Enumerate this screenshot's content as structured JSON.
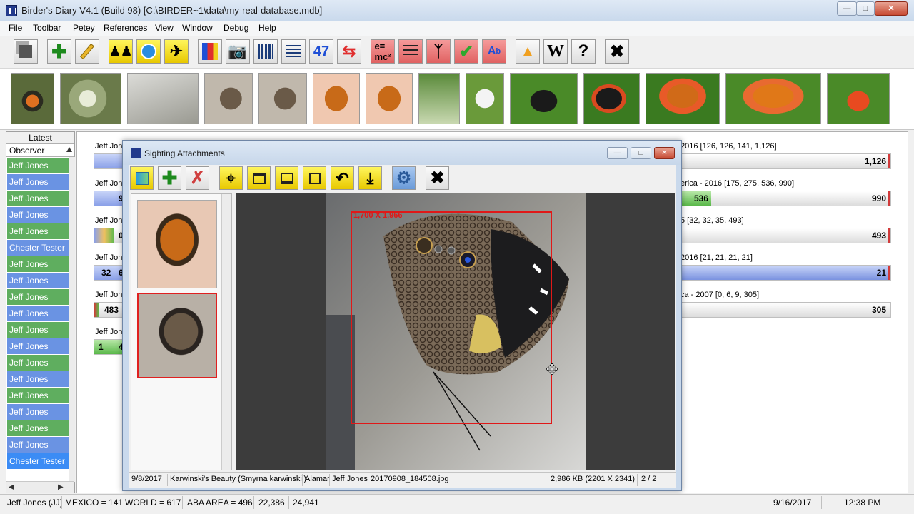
{
  "window": {
    "title": "Birder's Diary V4.1 (Build 98) [C:\\BIRDER~1\\data\\my-real-database.mdb]"
  },
  "menu": [
    "File",
    "Toolbar",
    "Petey",
    "References",
    "View",
    "Window",
    "Debug",
    "Help"
  ],
  "left_panel": {
    "latest_label": "Latest",
    "observer_header": "Observer",
    "rows": [
      {
        "name": "Jeff Jones",
        "color": "green"
      },
      {
        "name": "Jeff Jones",
        "color": "blue"
      },
      {
        "name": "Jeff Jones",
        "color": "green"
      },
      {
        "name": "Jeff Jones",
        "color": "blue"
      },
      {
        "name": "Jeff Jones",
        "color": "green"
      },
      {
        "name": "Chester Tester",
        "color": "blue"
      },
      {
        "name": "Jeff Jones",
        "color": "green"
      },
      {
        "name": "Jeff Jones",
        "color": "blue"
      },
      {
        "name": "Jeff Jones",
        "color": "green"
      },
      {
        "name": "Jeff Jones",
        "color": "blue"
      },
      {
        "name": "Jeff Jones",
        "color": "green"
      },
      {
        "name": "Jeff Jones",
        "color": "blue"
      },
      {
        "name": "Jeff Jones",
        "color": "green"
      },
      {
        "name": "Jeff Jones",
        "color": "blue"
      },
      {
        "name": "Jeff Jones",
        "color": "green"
      },
      {
        "name": "Jeff Jones",
        "color": "blue"
      },
      {
        "name": "Jeff Jones",
        "color": "green"
      },
      {
        "name": "Jeff Jones",
        "color": "blue"
      },
      {
        "name": "Chester Tester",
        "color": "selected"
      }
    ]
  },
  "stats": [
    {
      "left_label": "Jeff Jon",
      "right_label": "2016 [126, 126, 141, 1,126]",
      "left_value": "",
      "right_value": "1,126"
    },
    {
      "left_label": "Jeff Jon",
      "right_label": "erica - 2016 [175, 275, 536, 990]",
      "left_value": "9",
      "mid_value": "536",
      "right_value": "990"
    },
    {
      "left_label": "Jeff Jon",
      "right_label": "5 [32, 32, 35, 493]",
      "left_value": "0",
      "right_value": "493"
    },
    {
      "left_label": "Jeff Jon",
      "right_label": "2016 [21, 21, 21, 21]",
      "left_value": "32",
      "left_value2": "6",
      "right_value": "21"
    },
    {
      "left_label": "Jeff Jon",
      "right_label": "ca - 2007 [0, 6, 9, 305]",
      "left_value": "483",
      "right_value": "305"
    },
    {
      "left_label": "Jeff Jon",
      "right_label": "",
      "left_value": "1",
      "left_value2": "4",
      "right_value": ""
    }
  ],
  "dialog": {
    "title": "Sighting Attachments",
    "crop_label": "1,700 X 1,966",
    "status": {
      "date": "9/8/2017",
      "species": "Karwinski's Beauty (Smyrna karwinskii)",
      "location": "Alamar",
      "observer": "Jeff Jones",
      "filename": "20170908_184508.jpg",
      "fileinfo": "2,986 KB (2201 X 2341)",
      "page": "2 / 2"
    }
  },
  "statusbar": {
    "user": "Jeff Jones (JJ)",
    "mexico": "MEXICO = 141",
    "world": "WORLD = 617",
    "aba": "ABA AREA = 496",
    "n1": "22,386",
    "n2": "24,941",
    "date": "9/16/2017",
    "time": "12:38 PM"
  }
}
